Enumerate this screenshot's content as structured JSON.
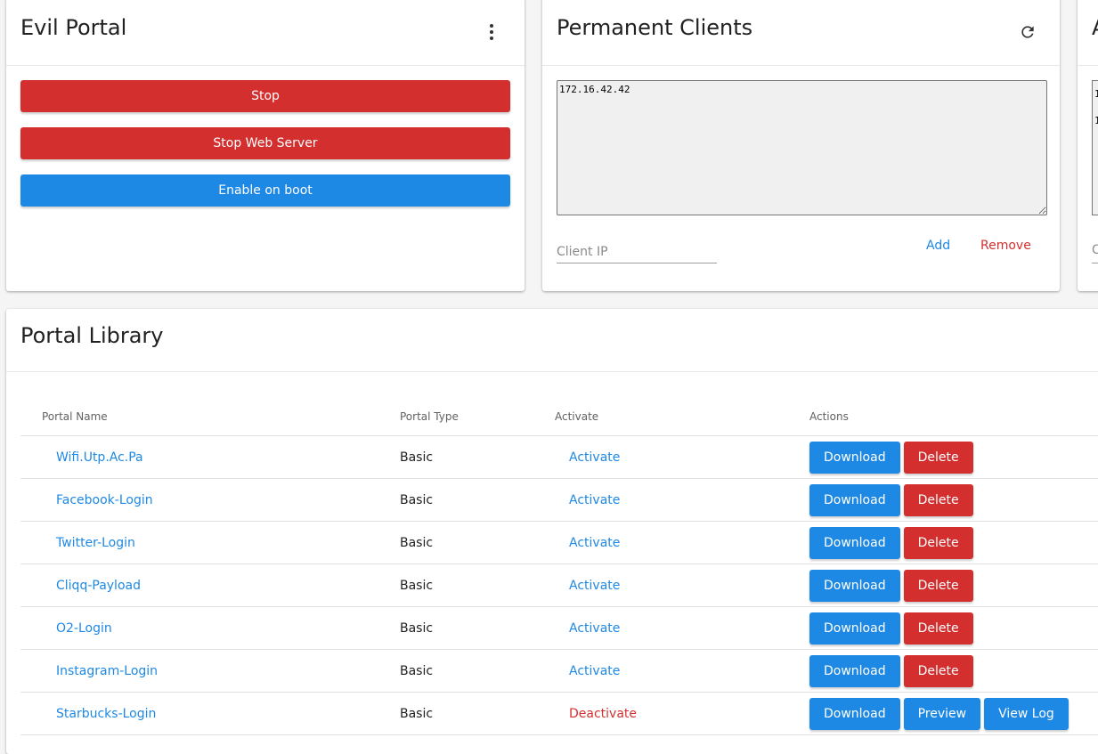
{
  "evil_portal": {
    "title": "Evil Portal",
    "stop_label": "Stop",
    "stop_web_server_label": "Stop Web Server",
    "enable_on_boot_label": "Enable on boot"
  },
  "permanent_clients": {
    "title": "Permanent Clients",
    "clients_text": "172.16.42.42",
    "client_ip_placeholder": "Client IP",
    "add_label": "Add",
    "remove_label": "Remove"
  },
  "third_card": {
    "title_fragment": "A",
    "text_fragment": "1\n1",
    "input_fragment": "C"
  },
  "portal_library": {
    "title": "Portal Library",
    "headers": {
      "name": "Portal Name",
      "type": "Portal Type",
      "activate": "Activate",
      "actions": "Actions"
    },
    "rows": [
      {
        "name": "Wifi.Utp.Ac.Pa",
        "type": "Basic",
        "activate": "Activate",
        "active": false,
        "download": "Download",
        "delete": "Delete"
      },
      {
        "name": "Facebook-Login",
        "type": "Basic",
        "activate": "Activate",
        "active": false,
        "download": "Download",
        "delete": "Delete"
      },
      {
        "name": "Twitter-Login",
        "type": "Basic",
        "activate": "Activate",
        "active": false,
        "download": "Download",
        "delete": "Delete"
      },
      {
        "name": "Cliqq-Payload",
        "type": "Basic",
        "activate": "Activate",
        "active": false,
        "download": "Download",
        "delete": "Delete"
      },
      {
        "name": "O2-Login",
        "type": "Basic",
        "activate": "Activate",
        "active": false,
        "download": "Download",
        "delete": "Delete"
      },
      {
        "name": "Instagram-Login",
        "type": "Basic",
        "activate": "Activate",
        "active": false,
        "download": "Download",
        "delete": "Delete"
      },
      {
        "name": "Starbucks-Login",
        "type": "Basic",
        "activate": "Deactivate",
        "active": true,
        "download": "Download",
        "preview": "Preview",
        "view_log": "View Log"
      }
    ]
  },
  "colors": {
    "primary_blue": "#1e88e5",
    "danger_red": "#d32f2f"
  },
  "icons": {
    "menu": "more-vert-icon",
    "refresh": "refresh-icon"
  }
}
